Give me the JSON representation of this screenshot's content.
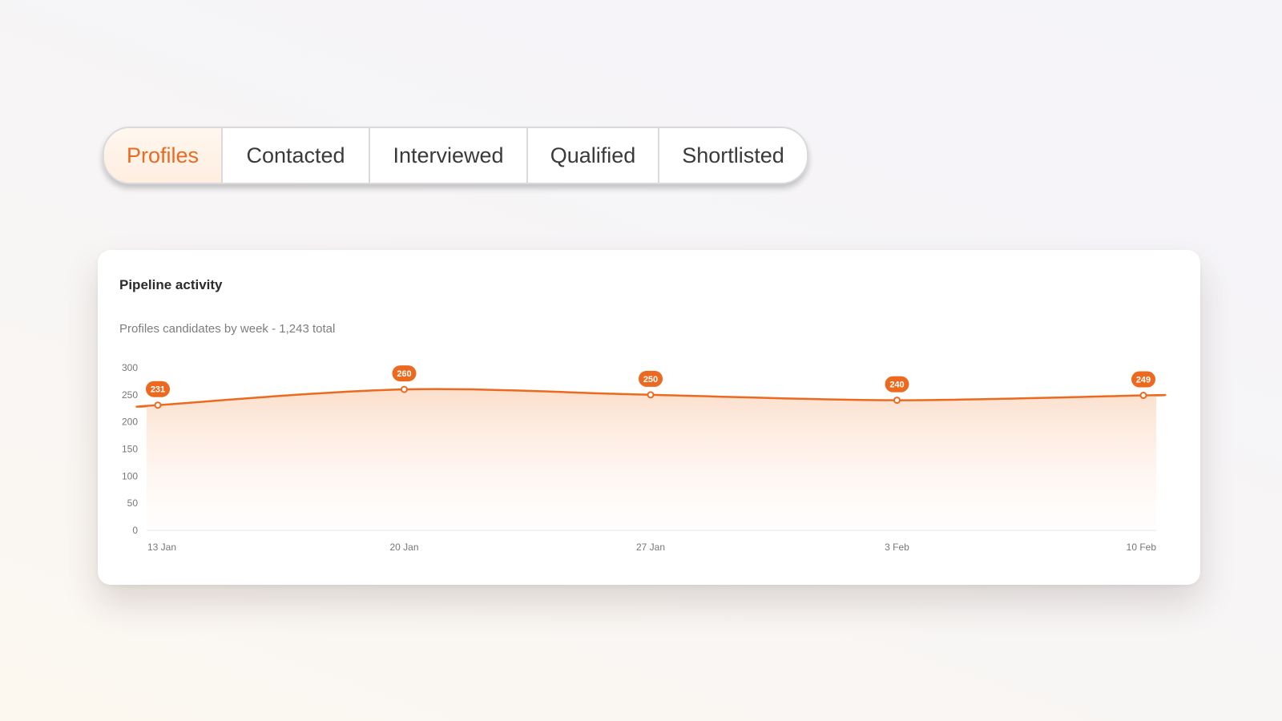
{
  "tabs": [
    {
      "label": "Profiles",
      "active": true
    },
    {
      "label": "Contacted",
      "active": false
    },
    {
      "label": "Interviewed",
      "active": false
    },
    {
      "label": "Qualified",
      "active": false
    },
    {
      "label": "Shortlisted",
      "active": false
    }
  ],
  "card": {
    "title": "Pipeline activity",
    "subtitle": "Profiles candidates by week - 1,243 total"
  },
  "colors": {
    "accent": "#ec6a1f",
    "grid": "#e6e6e6",
    "tick": "#777777"
  },
  "chart_data": {
    "type": "area",
    "x": [
      "13 Jan",
      "20 Jan",
      "27 Jan",
      "3 Feb",
      "10 Feb"
    ],
    "series": [
      {
        "values": [
          231,
          260,
          250,
          240,
          249
        ],
        "color": "#ec6a1f"
      }
    ],
    "ylim": [
      0,
      300
    ],
    "yticks": [
      0,
      50,
      100,
      150,
      200,
      250,
      300
    ],
    "grid": false,
    "legend": "none",
    "data_labels": true
  }
}
